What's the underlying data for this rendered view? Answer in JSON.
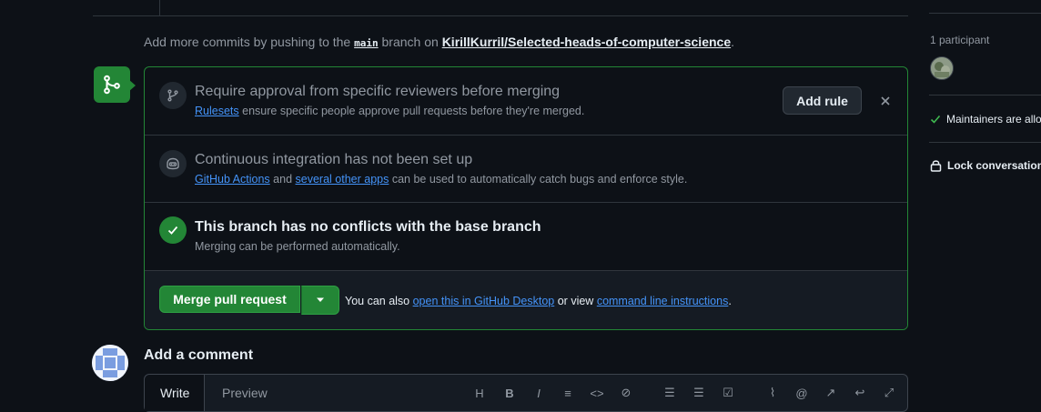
{
  "timeline": {
    "hint_prefix": "Add more commits by pushing to the",
    "branch": "main",
    "hint_mid": "branch on",
    "repo": "KirillKurril/Selected-heads-of-computer-science",
    "hint_suffix": "."
  },
  "merge_box": {
    "rule": {
      "title": "Require approval from specific reviewers before merging",
      "link": "Rulesets",
      "text": "ensure specific people approve pull requests before they're merged.",
      "button": "Add rule",
      "close_icon": "x-icon"
    },
    "ci": {
      "title": "Continuous integration has not been set up",
      "link1": "GitHub Actions",
      "and": "and",
      "link2": "several other apps",
      "text": "can be used to automatically catch bugs and enforce style."
    },
    "conflicts": {
      "title": "This branch has no conflicts with the base branch",
      "subtitle": "Merging can be performed automatically."
    },
    "merge": {
      "button": "Merge pull request",
      "hint_prefix": "You can also",
      "link1": "open this in GitHub Desktop",
      "or_view": "or view",
      "link2": "command line instructions",
      "hint_suffix": "."
    }
  },
  "comment": {
    "title": "Add a comment",
    "tab_write": "Write",
    "tab_preview": "Preview",
    "toolbar": [
      "heading-icon",
      "bold-icon",
      "italic-icon",
      "quote-icon",
      "code-icon",
      "link-icon",
      "ordered-list-icon",
      "unordered-list-icon",
      "task-list-icon",
      "attach-icon",
      "mention-icon",
      "reference-icon",
      "reply-icon",
      "fullscreen-icon"
    ]
  },
  "sidebar": {
    "participants": "1 participant",
    "maintainers": "Maintainers are allo",
    "lock": "Lock conversation"
  },
  "colors": {
    "background": "#0d1117",
    "success": "#238636",
    "link": "#4493f8",
    "border": "#30363d",
    "muted": "#9198a1"
  }
}
